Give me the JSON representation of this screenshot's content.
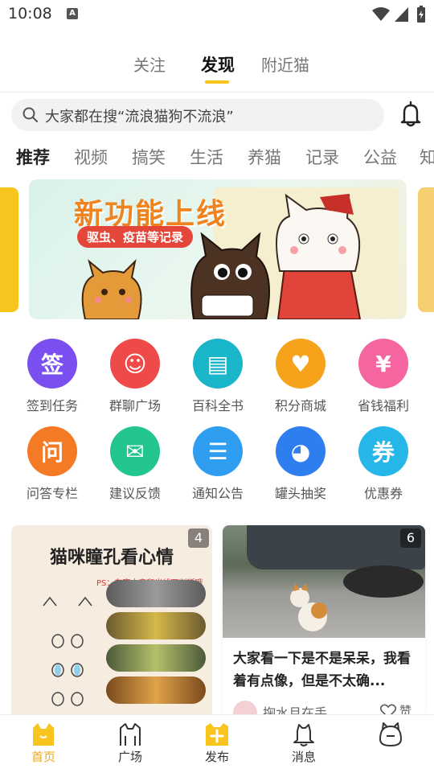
{
  "status": {
    "time": "10:08",
    "a_badge": "A"
  },
  "top_tabs": [
    {
      "label": "关注"
    },
    {
      "label": "发现"
    },
    {
      "label": "附近猫"
    }
  ],
  "search": {
    "text": "大家都在搜“流浪猫狗不流浪”"
  },
  "categories": [
    {
      "label": "推荐"
    },
    {
      "label": "视频"
    },
    {
      "label": "搞笑"
    },
    {
      "label": "生活"
    },
    {
      "label": "养猫"
    },
    {
      "label": "记录"
    },
    {
      "label": "公益"
    },
    {
      "label": "知"
    }
  ],
  "banner": {
    "title": "新功能上线",
    "subtitle": "驱虫、疫苗等记录"
  },
  "grid": [
    {
      "label": "签到任务",
      "glyph": "签",
      "color": "#7a4ff0"
    },
    {
      "label": "群聊广场",
      "glyph": "☺",
      "color": "#ee4a4a"
    },
    {
      "label": "百科全书",
      "glyph": "▤",
      "color": "#19b5c9"
    },
    {
      "label": "积分商城",
      "glyph": "♥",
      "color": "#f6a21b"
    },
    {
      "label": "省钱福利",
      "glyph": "¥",
      "color": "#f565a0"
    },
    {
      "label": "问答专栏",
      "glyph": "问",
      "color": "#f57a26"
    },
    {
      "label": "建议反馈",
      "glyph": "✉",
      "color": "#22c48f"
    },
    {
      "label": "通知公告",
      "glyph": "☰",
      "color": "#2f9ef0"
    },
    {
      "label": "罐头抽奖",
      "glyph": "◕",
      "color": "#2f7ef0"
    },
    {
      "label": "优惠券",
      "glyph": "券",
      "color": "#27b6e8"
    }
  ],
  "cards": [
    {
      "title": "猫咪瞳孔看心情",
      "ps": "PS：在室内表和光线下判断哦",
      "count": "4"
    },
    {
      "title": "大家看一下是不是呆呆，我看着有点像，但是不太确...",
      "author": "掬水月在手",
      "like": "赞",
      "count": "6"
    }
  ],
  "bottom_nav": [
    {
      "label": "首页"
    },
    {
      "label": "广场"
    },
    {
      "label": "发布"
    },
    {
      "label": "消息"
    },
    {
      "label": ""
    }
  ],
  "colors": {
    "accent": "#f7c51e",
    "active_tab": "#f0a81a"
  }
}
